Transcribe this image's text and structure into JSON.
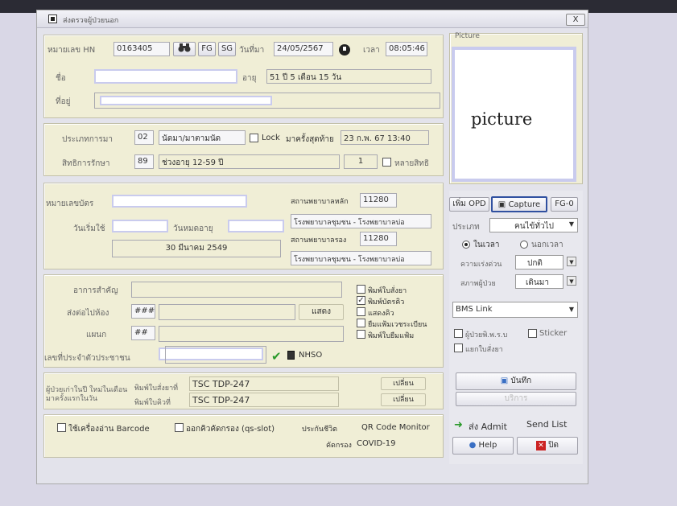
{
  "window": {
    "title": "ส่งตรวจผู้ป่วยนอก",
    "close_label": "X"
  },
  "header": {
    "hn_label": "หมายเลข HN",
    "hn_value": "0163405",
    "fg_label": "FG",
    "sg_label": "SG",
    "date_label": "วันที่มา",
    "date_value": "24/05/2567",
    "time_label": "เวลา",
    "time_value": "08:05:46",
    "name_label": "ชื่อ",
    "age_label": "อายุ",
    "age_value": "51 ปี 5 เดือน 15 วัน",
    "address_label": "ที่อยู่"
  },
  "visit": {
    "type_label": "ประเภทการมา",
    "type_code": "02",
    "type_name": "นัดมา/มาตามนัด",
    "lock_label": "Lock",
    "last_visit_label": "มาครั้งสุดท้าย",
    "last_visit_value": "23 ก.พ. 67 13:40",
    "right_label": "สิทธิการรักษา",
    "right_code": "89",
    "right_name": "ช่วงอายุ 12-59 ปี",
    "right_count": "1",
    "multi_right_label": "หลายสิทธิ"
  },
  "card": {
    "card_no_label": "หมายเลขบัตร",
    "start_label": "วันเริ่มใช้",
    "expire_label": "วันหมดอายุ",
    "date_value": "30 มีนาคม 2549",
    "main_hosp_label": "สถานพยาบาลหลัก",
    "main_hosp_code": "11280",
    "main_hosp_name": "โรงพยาบาลชุมชน - โรงพยาบาลบ่อ",
    "sub_hosp_label": "สถานพยาบาลรอง",
    "sub_hosp_code": "11280",
    "sub_hosp_name": "โรงพยาบาลชุมชน - โรงพยาบาลบ่อ"
  },
  "referral": {
    "symptom_label": "อาการสำคัญ",
    "room_label": "ส่งต่อไปห้อง",
    "room_value": "###",
    "show_label": "แสดง",
    "dept_label": "แผนก",
    "dept_value": "##",
    "id_label": "เลขที่ประจำตัวประชาชน",
    "nhso_label": "NHSO",
    "print_options": [
      {
        "label": "พิมพ์ใบสั่งยา",
        "checked": false
      },
      {
        "label": "พิมพ์บัตรคิว",
        "checked": true
      },
      {
        "label": "แสดงคิว",
        "checked": false
      },
      {
        "label": "ยืมแฟ้มเวชระเบียน",
        "checked": false
      },
      {
        "label": "พิมพ์ใบยืมแฟ้ม",
        "checked": false
      }
    ]
  },
  "printers": {
    "patient_note": "ผู้ป่วยเก่าในปี ใหม่ในเดือน มาครั้งแรกในวัน",
    "rx_printer_label": "พิมพ์ใบสั่งยาที่",
    "rx_printer_value": "TSC TDP-247",
    "queue_printer_label": "พิมพ์ใบคิวที่",
    "queue_printer_value": "TSC TDP-247",
    "change_label": "เปลี่ยน"
  },
  "footer": {
    "barcode_label": "ใช้เครื่องอ่าน Barcode",
    "queue_slot_label": "ออกคิวคัดกรอง (qs-slot)",
    "insurance_label": "ประกันชีวิต",
    "screening_label": "คัดกรอง",
    "qr_label": "QR Code Monitor",
    "covid_label": "COVID-19"
  },
  "side": {
    "picture_group_label": "Picture",
    "picture_text": "picture",
    "opd_label": "เพิ่ม OPD",
    "capture_label": "Capture",
    "fg0_label": "FG-0",
    "type_label": "ประเภท",
    "type_value": "คนไข้ทั่วไป",
    "in_time_label": "ในเวลา",
    "out_time_label": "นอกเวลา",
    "urgency_label": "ความเร่งด่วน",
    "urgency_value": "ปกติ",
    "status_label": "สภาพผู้ป่วย",
    "status_value": "เดินมา",
    "bms_label": "BMS Link",
    "handicap_label": "ผู้ป่วยพิ.พ.ร.บ",
    "sticker_label": "Sticker",
    "split_rx_label": "แยกใบสั่งยา",
    "save_label": "บันทึก",
    "service_label": "บริการ",
    "admit_label": "ส่ง Admit",
    "send_list_label": "Send List",
    "help_label": "Help",
    "close_label": "ปิด"
  },
  "colors": {
    "panel": "#f0eed6",
    "redact_border": "#c9cbee",
    "close_red": "#cc2222",
    "save_blue": "#3a6fc4"
  }
}
